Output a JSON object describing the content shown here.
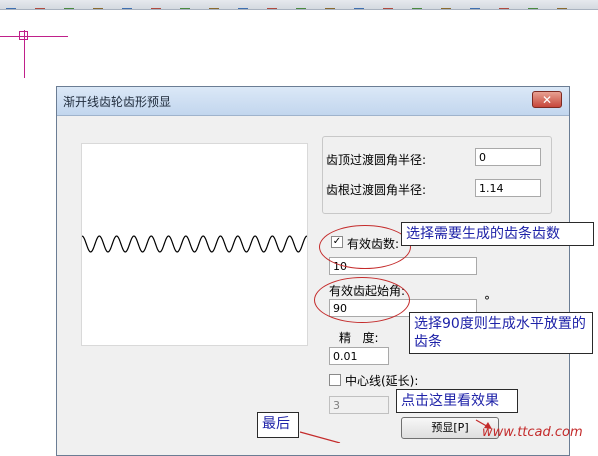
{
  "toolbar": {
    "icons": [
      "tool-icon-1",
      "tool-icon-2",
      "tool-icon-3",
      "tool-icon-4",
      "tool-icon-5",
      "tool-icon-6",
      "tool-icon-7",
      "tool-icon-8",
      "tool-icon-9",
      "tool-icon-10",
      "tool-icon-11",
      "tool-icon-12",
      "tool-icon-13",
      "tool-icon-14",
      "tool-icon-15",
      "tool-icon-16",
      "tool-icon-17",
      "tool-icon-18",
      "tool-icon-19",
      "tool-icon-20"
    ]
  },
  "dialog": {
    "title": "渐开线齿轮齿形预显",
    "close_label": "✕",
    "tip_fillet_label": "齿顶过渡圆角半径:",
    "tip_fillet_value": "0",
    "root_fillet_label": "齿根过渡圆角半径:",
    "root_fillet_value": "1.14",
    "effective_teeth_label": "有效齿数:",
    "effective_teeth_checked": true,
    "effective_teeth_value": "10",
    "start_angle_label": "有效齿起始角:",
    "start_angle_value": "90",
    "degree_symbol": "°",
    "precision_label": "精   度:",
    "precision_value": "0.01",
    "centerline_label": "中心线(延长):",
    "centerline_checked": false,
    "centerline_value": "3",
    "preview_button": "预显[P]"
  },
  "annotations": {
    "select_teeth": "选择需要生成的齿条齿数",
    "select_angle": "选择90度则生成水平放置的齿条",
    "click_preview": "点击这里看效果",
    "finally": "最后"
  },
  "watermark": "www.ttcad.com",
  "colors": {
    "annotation_text": "#1e22a8",
    "annotation_ellipse": "#c42b2b",
    "crosshair": "#c0208a"
  }
}
